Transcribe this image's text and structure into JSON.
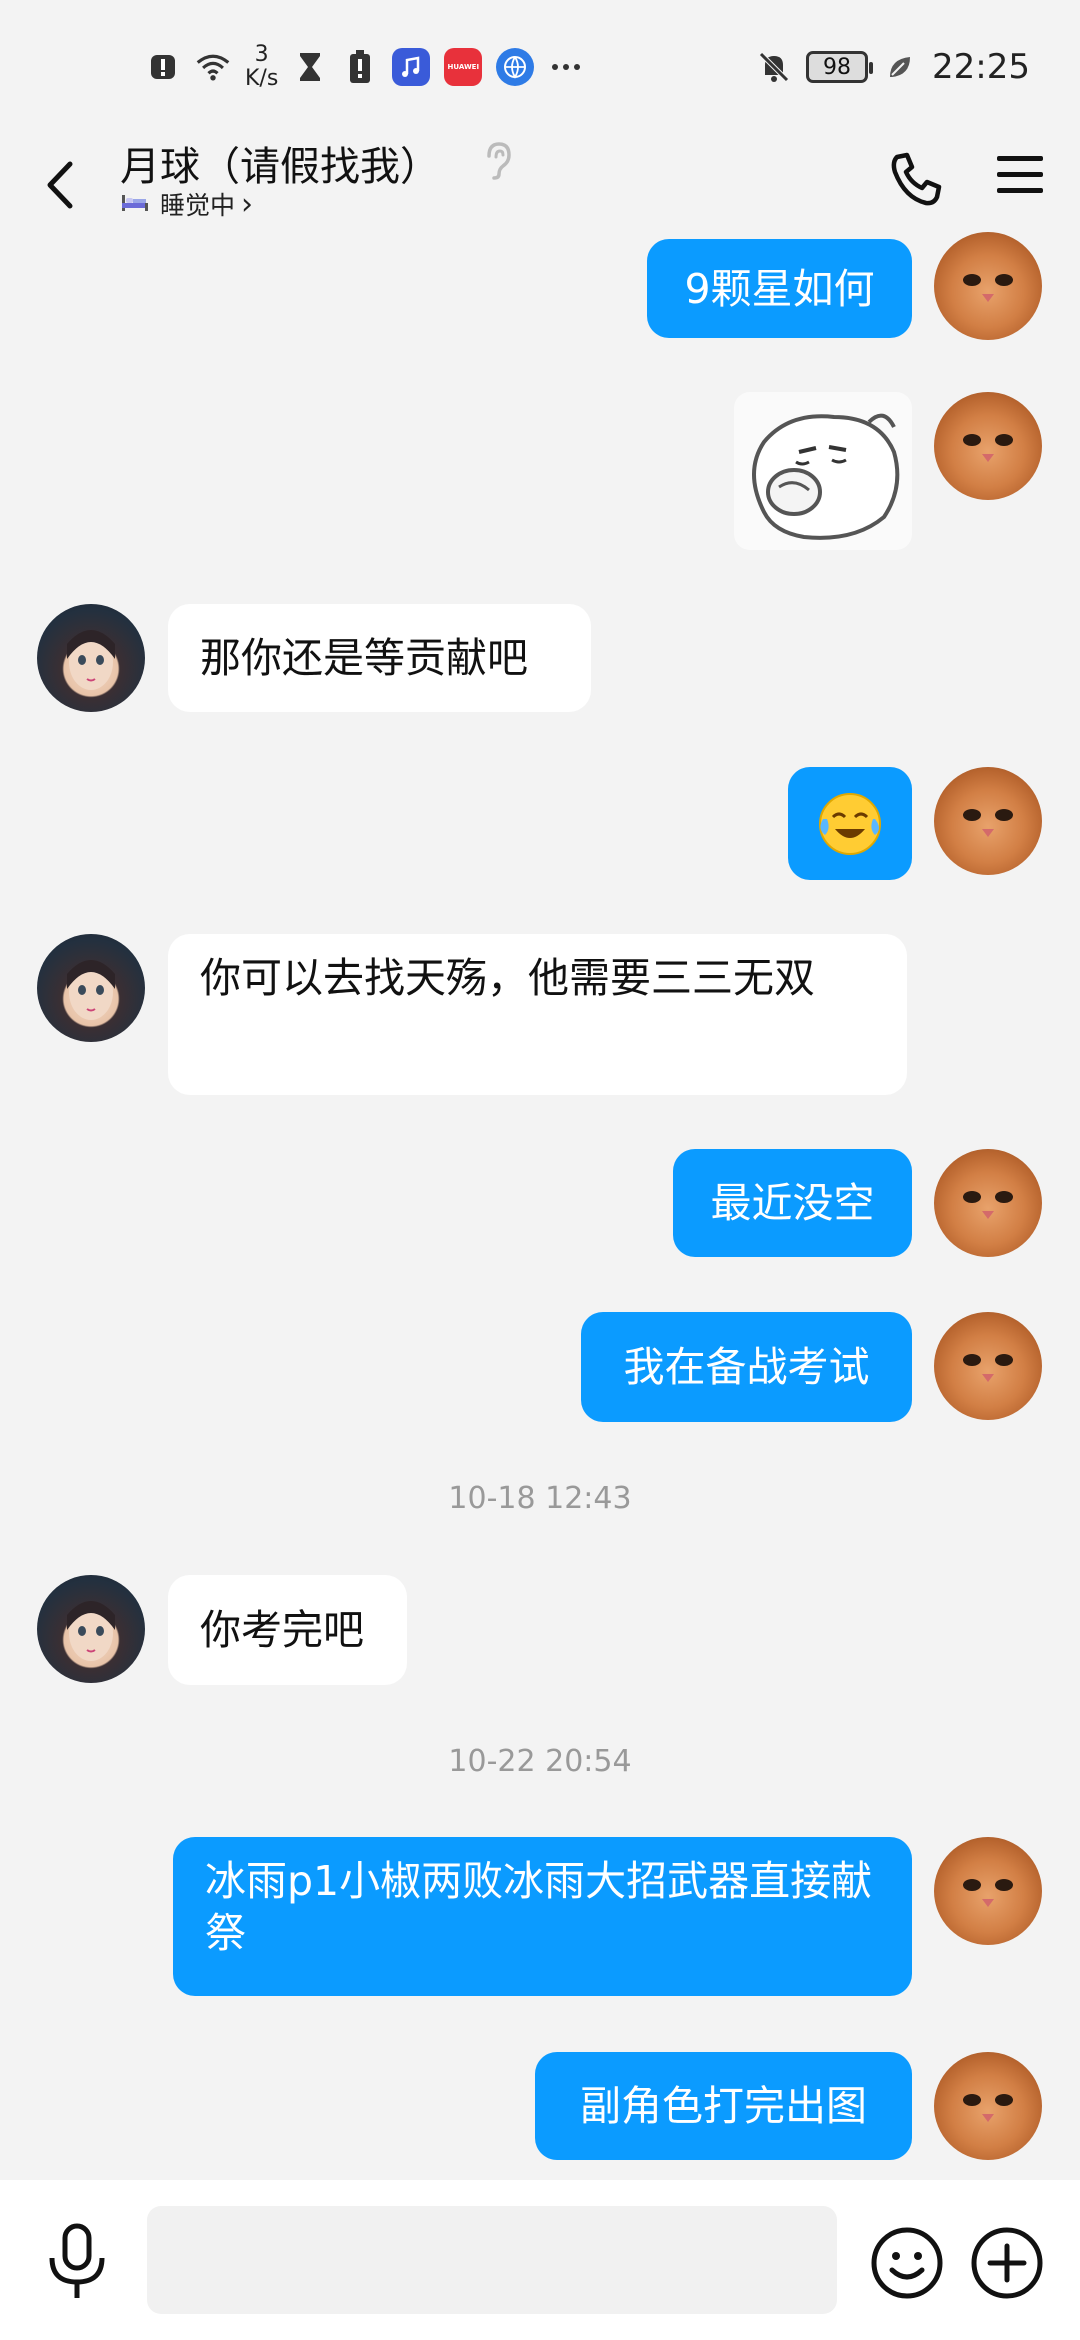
{
  "status_bar": {
    "net_speed_value": "3",
    "net_speed_unit": "K/s",
    "time": "22:25",
    "battery": "98",
    "app_badge_text": "HUAWEI"
  },
  "header": {
    "title": "月球（请假找我）",
    "status": "睡觉中",
    "status_arrow": "›"
  },
  "messages": [
    {
      "from": "me",
      "type": "text",
      "text": "9颗星如何"
    },
    {
      "from": "me",
      "type": "sticker"
    },
    {
      "from": "them",
      "type": "text",
      "text": "那你还是等贡献吧"
    },
    {
      "from": "me",
      "type": "emoji",
      "icon": "crying-laughing-emoji"
    },
    {
      "from": "them",
      "type": "text",
      "text": "你可以去找天殇，他需要三三无双"
    },
    {
      "from": "me",
      "type": "text",
      "text": "最近没空"
    },
    {
      "from": "me",
      "type": "text",
      "text": "我在备战考试"
    },
    {
      "from": "system",
      "type": "time",
      "text": "10-18 12:43"
    },
    {
      "from": "them",
      "type": "text",
      "text": "你考完吧"
    },
    {
      "from": "system",
      "type": "time",
      "text": "10-22 20:54"
    },
    {
      "from": "me",
      "type": "text",
      "text": "冰雨p1小椒两败冰雨大招武器直接献祭"
    },
    {
      "from": "me",
      "type": "text",
      "text": "副角色打完出图"
    }
  ],
  "input": {
    "placeholder": ""
  },
  "colors": {
    "my_bubble": "#0b9bff",
    "their_bubble": "#ffffff",
    "background": "#f3f3f3"
  }
}
